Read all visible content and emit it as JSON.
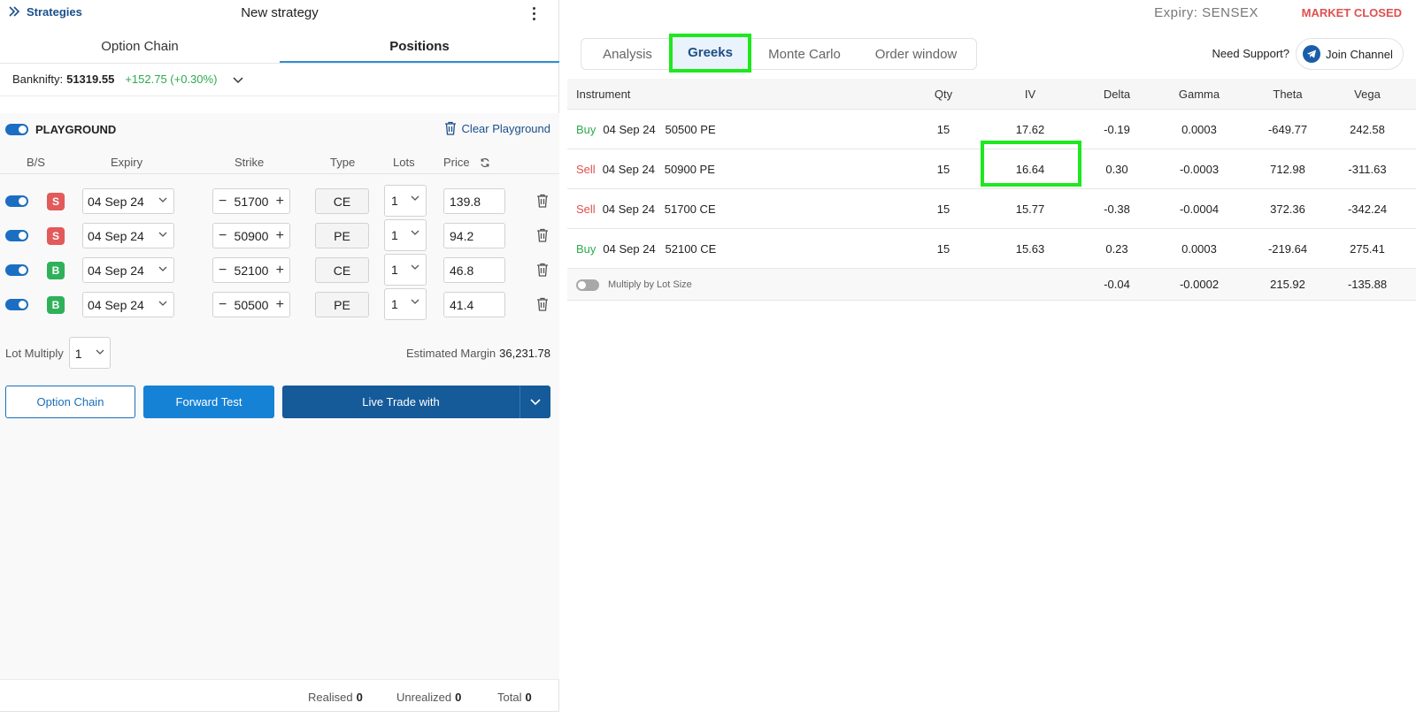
{
  "header": {
    "back_label": "Strategies",
    "title": "New strategy"
  },
  "left_tabs": [
    "Option Chain",
    "Positions"
  ],
  "index": {
    "name": "Banknifty:",
    "price": "51319.55",
    "change": "+152.75 (+0.30%)"
  },
  "playground": {
    "label": "PLAYGROUND",
    "clear_label": "Clear Playground",
    "columns": {
      "bs": "B/S",
      "expiry": "Expiry",
      "strike": "Strike",
      "type": "Type",
      "lots": "Lots",
      "price": "Price"
    },
    "legs": [
      {
        "side": "S",
        "expiry": "04 Sep 24",
        "strike": "51700",
        "type": "CE",
        "lots": "1",
        "price": "139.8"
      },
      {
        "side": "S",
        "expiry": "04 Sep 24",
        "strike": "50900",
        "type": "PE",
        "lots": "1",
        "price": "94.2"
      },
      {
        "side": "B",
        "expiry": "04 Sep 24",
        "strike": "52100",
        "type": "CE",
        "lots": "1",
        "price": "46.8"
      },
      {
        "side": "B",
        "expiry": "04 Sep 24",
        "strike": "50500",
        "type": "PE",
        "lots": "1",
        "price": "41.4"
      }
    ],
    "lot_multiply_label": "Lot Multiply",
    "lot_multiply_value": "1",
    "margin_label": "Estimated Margin",
    "margin_value": "36,231.78"
  },
  "actions": {
    "option_chain": "Option Chain",
    "forward_test": "Forward Test",
    "live_trade": "Live Trade with"
  },
  "footer": {
    "realised_label": "Realised",
    "realised_value": "0",
    "unrealized_label": "Unrealized",
    "unrealized_value": "0",
    "total_label": "Total",
    "total_value": "0"
  },
  "right_header": {
    "expiry": "Expiry:  SENSEX",
    "market_status": "MARKET CLOSED",
    "support_label": "Need Support?",
    "join_label": "Join Channel"
  },
  "right_tabs": [
    "Analysis",
    "Greeks",
    "Monte Carlo",
    "Order window"
  ],
  "greeks_table": {
    "columns": [
      "Instrument",
      "Qty",
      "IV",
      "Delta",
      "Gamma",
      "Theta",
      "Vega"
    ],
    "rows": [
      {
        "side": "Buy",
        "instrument": "04 Sep 24   50500 PE",
        "qty": "15",
        "iv": "17.62",
        "delta": "-0.19",
        "gamma": "0.0003",
        "theta": "-649.77",
        "vega": "242.58"
      },
      {
        "side": "Sell",
        "instrument": "04 Sep 24   50900 PE",
        "qty": "15",
        "iv": "16.64",
        "delta": "0.30",
        "gamma": "-0.0003",
        "theta": "712.98",
        "vega": "-311.63"
      },
      {
        "side": "Sell",
        "instrument": "04 Sep 24   51700 CE",
        "qty": "15",
        "iv": "15.77",
        "delta": "-0.38",
        "gamma": "-0.0004",
        "theta": "372.36",
        "vega": "-342.24"
      },
      {
        "side": "Buy",
        "instrument": "04 Sep 24   52100 CE",
        "qty": "15",
        "iv": "15.63",
        "delta": "0.23",
        "gamma": "0.0003",
        "theta": "-219.64",
        "vega": "275.41"
      }
    ],
    "multiply_label": "Multiply by Lot Size",
    "totals": {
      "delta": "-0.04",
      "gamma": "-0.0002",
      "theta": "215.92",
      "vega": "-135.88"
    }
  },
  "colors": {
    "accent": "#1582d6",
    "buy": "#2eaa4f",
    "sell": "#e05050",
    "highlight": "#1ee81e"
  }
}
